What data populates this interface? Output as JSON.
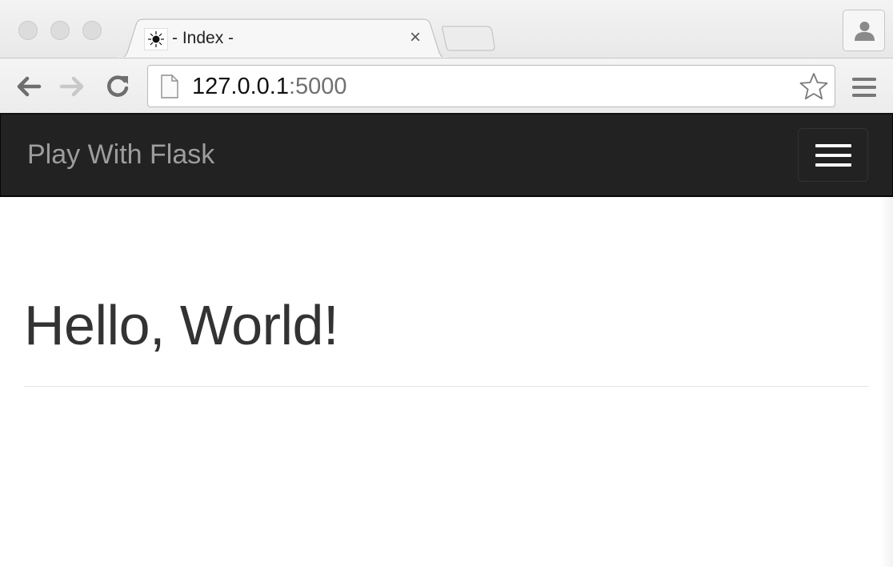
{
  "browser": {
    "tab": {
      "title": "- Index -",
      "close_label": "×"
    },
    "address_bar": {
      "host": "127.0.0.1",
      "port": ":5000"
    }
  },
  "page": {
    "navbar": {
      "brand": "Play With Flask"
    },
    "heading": "Hello, World!"
  },
  "colors": {
    "navbar_bg": "#222222",
    "brand_text": "#9d9d9d",
    "heading_text": "#333333"
  },
  "icons": [
    "favicon-icon",
    "close-icon",
    "profile-icon",
    "back-arrow-icon",
    "forward-arrow-icon",
    "reload-icon",
    "page-icon",
    "star-icon",
    "menu-icon",
    "hamburger-icon"
  ]
}
